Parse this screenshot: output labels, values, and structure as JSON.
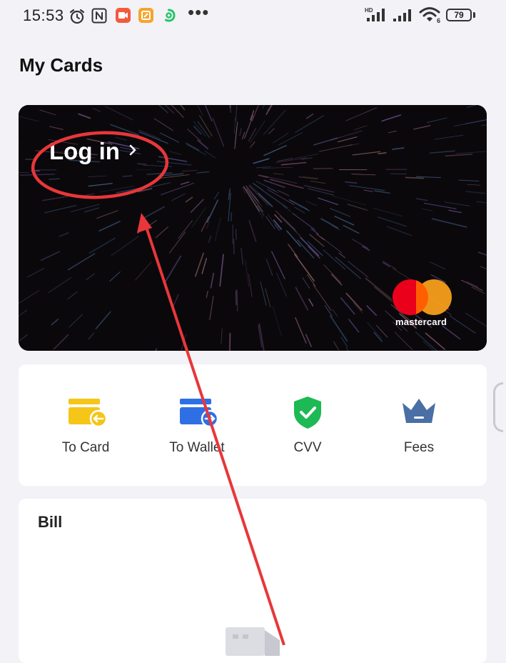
{
  "status_bar": {
    "time": "15:53",
    "network_label": "HD",
    "wifi_badge": "6",
    "battery_level": "79"
  },
  "page": {
    "title": "My Cards"
  },
  "card": {
    "login_label": "Log in",
    "brand": "mastercard"
  },
  "actions": [
    {
      "label": "To Card",
      "icon": "card-transfer-icon",
      "color": "#f5c518"
    },
    {
      "label": "To Wallet",
      "icon": "wallet-transfer-icon",
      "color": "#2f6fe4"
    },
    {
      "label": "CVV",
      "icon": "shield-check-icon",
      "color": "#1db954"
    },
    {
      "label": "Fees",
      "icon": "crown-icon",
      "color": "#4a6fa5"
    }
  ],
  "bill": {
    "title": "Bill"
  },
  "colors": {
    "background": "#f2f2f7",
    "annotation": "#e8373a",
    "mastercard_red": "#eb001b",
    "mastercard_yellow": "#f79e1b"
  }
}
